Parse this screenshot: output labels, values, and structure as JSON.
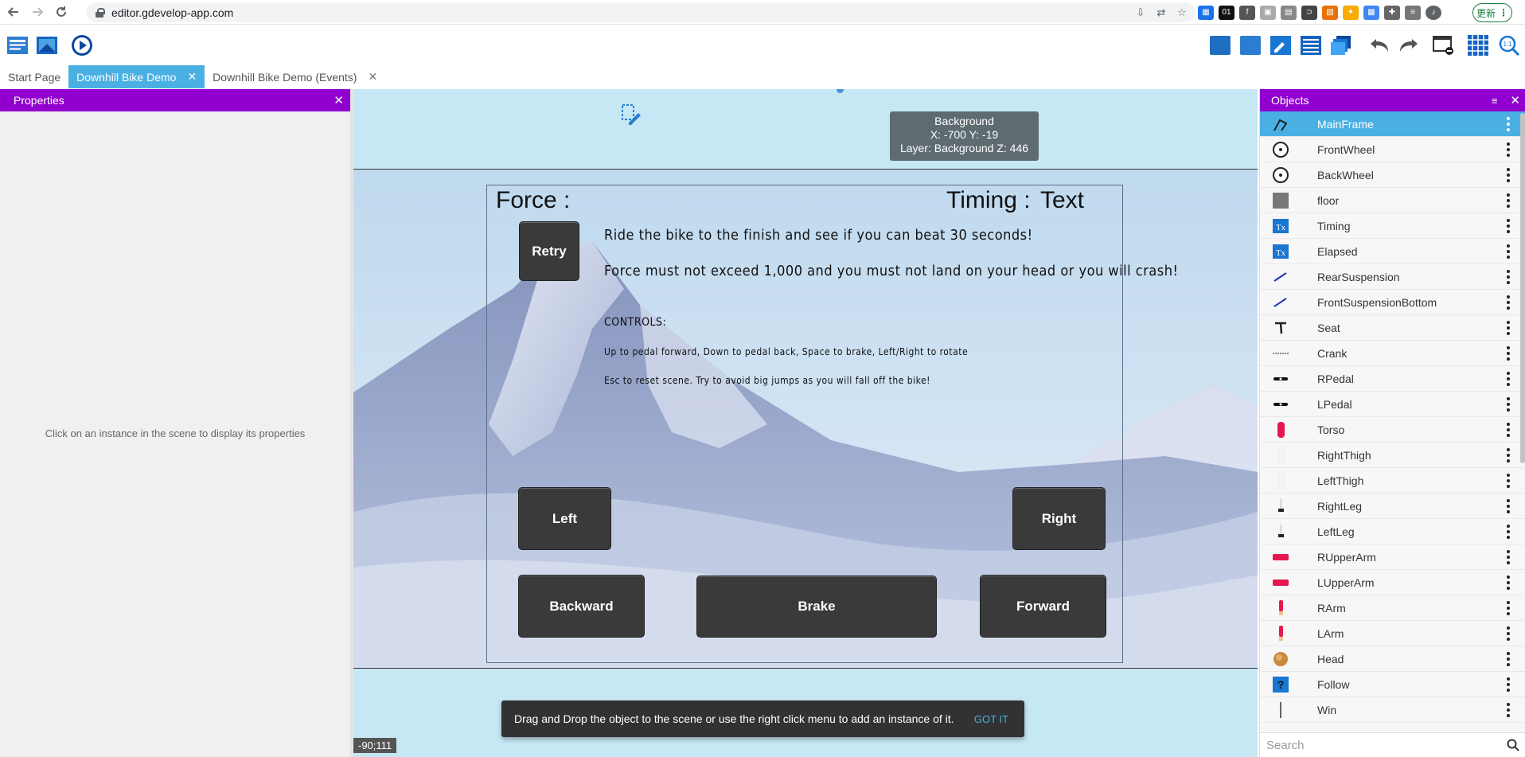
{
  "browser": {
    "url": "editor.gdevelop-app.com",
    "update_label": "更新"
  },
  "tabs": [
    {
      "label": "Start Page"
    },
    {
      "label": "Downhill Bike Demo"
    },
    {
      "label": "Downhill Bike Demo (Events)"
    }
  ],
  "properties": {
    "title": "Properties",
    "empty_message": "Click on an instance in the scene to display its properties"
  },
  "scene": {
    "tooltip": {
      "line1": "Background",
      "line2": "X: -700  Y: -19",
      "line3": "Layer: Background  Z: 446"
    },
    "force_label": "Force :",
    "timing_label": "Timing :",
    "timing_value": "Text",
    "instructions": [
      "Ride the bike to the finish and see if you can beat 30 seconds!",
      "Force must not exceed 1,000 and you must not land on your head or you will crash!"
    ],
    "controls_title": "CONTROLS:",
    "controls_line1": "Up to pedal forward, Down to pedal back, Space to brake, Left/Right to rotate",
    "controls_line2": "Esc to reset scene.  Try to avoid big jumps as you will fall off the bike!",
    "buttons": {
      "retry": "Retry",
      "left": "Left",
      "right": "Right",
      "backward": "Backward",
      "brake": "Brake",
      "forward": "Forward"
    },
    "coords": "-90;111",
    "snackbar_text": "Drag and Drop the object to the scene or use the right click menu to add an instance of it.",
    "snackbar_action": "GOT IT"
  },
  "objects": {
    "title": "Objects",
    "search_placeholder": "Search",
    "items": [
      {
        "name": "MainFrame",
        "icon": "frame-icon"
      },
      {
        "name": "FrontWheel",
        "icon": "wheel-icon"
      },
      {
        "name": "BackWheel",
        "icon": "wheel-icon"
      },
      {
        "name": "floor",
        "icon": "floor-icon"
      },
      {
        "name": "Timing",
        "icon": "text-object-icon"
      },
      {
        "name": "Elapsed",
        "icon": "text-object-icon"
      },
      {
        "name": "RearSuspension",
        "icon": "suspension-icon"
      },
      {
        "name": "FrontSuspensionBottom",
        "icon": "suspension-icon"
      },
      {
        "name": "Seat",
        "icon": "seat-icon"
      },
      {
        "name": "Crank",
        "icon": "crank-icon"
      },
      {
        "name": "RPedal",
        "icon": "pedal-icon"
      },
      {
        "name": "LPedal",
        "icon": "pedal-icon"
      },
      {
        "name": "Torso",
        "icon": "torso-icon"
      },
      {
        "name": "RightThigh",
        "icon": "thigh-icon"
      },
      {
        "name": "LeftThigh",
        "icon": "thigh-icon"
      },
      {
        "name": "RightLeg",
        "icon": "leg-icon"
      },
      {
        "name": "LeftLeg",
        "icon": "leg-icon"
      },
      {
        "name": "RUpperArm",
        "icon": "upper-arm-icon"
      },
      {
        "name": "LUpperArm",
        "icon": "upper-arm-icon"
      },
      {
        "name": "RArm",
        "icon": "arm-icon"
      },
      {
        "name": "LArm",
        "icon": "arm-icon"
      },
      {
        "name": "Head",
        "icon": "head-icon"
      },
      {
        "name": "Follow",
        "icon": "question-icon"
      },
      {
        "name": "Win",
        "icon": "line-icon"
      }
    ]
  },
  "colors": {
    "panel_header": "#9100ce",
    "accent": "#4ab0e4",
    "scene_bg": "#c6e7f4"
  }
}
